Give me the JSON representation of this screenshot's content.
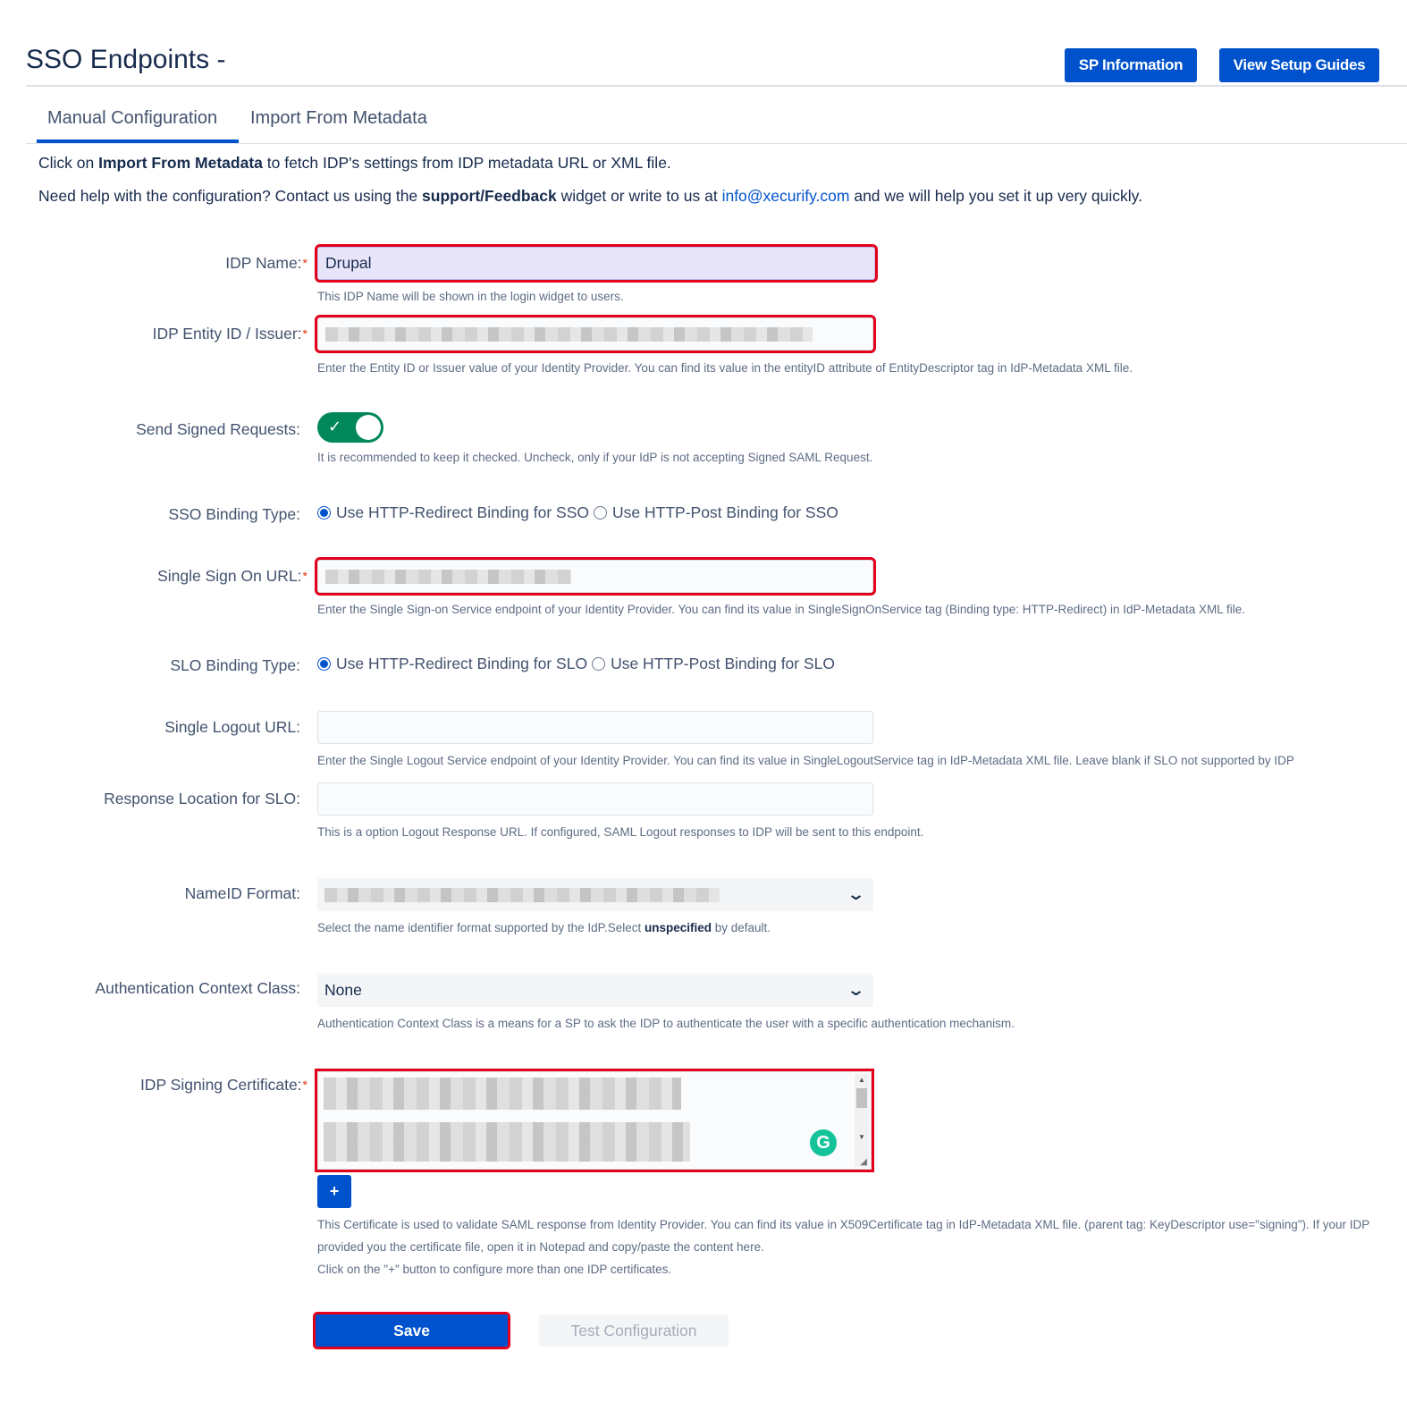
{
  "header": {
    "title": "SSO Endpoints -",
    "sp_info_label": "SP Information",
    "setup_guides_label": "View Setup Guides"
  },
  "tabs": [
    {
      "label": "Manual Configuration",
      "active": true
    },
    {
      "label": "Import From Metadata",
      "active": false
    }
  ],
  "intro": {
    "line1_pre": "Click on ",
    "line1_bold": "Import From Metadata",
    "line1_post": " to fetch IDP's settings from IDP metadata URL or XML file.",
    "line2_pre": "Need help with the configuration? Contact us using the ",
    "line2_bold": "support/Feedback",
    "line2_mid": " widget or write to us at ",
    "line2_link": "info@xecurify.com",
    "line2_post": " and we will help you set it up very quickly."
  },
  "form": {
    "idp_name": {
      "label": "IDP Name:",
      "value": "Drupal",
      "help": "This IDP Name will be shown in the login widget to users."
    },
    "entity_id": {
      "label": "IDP Entity ID / Issuer:",
      "help": "Enter the Entity ID or Issuer value of your Identity Provider. You can find its value in the entityID attribute of EntityDescriptor tag in IdP-Metadata XML file."
    },
    "signed_requests": {
      "label": "Send Signed Requests:",
      "checked": true,
      "help": "It is recommended to keep it checked. Uncheck, only if your IdP is not accepting Signed SAML Request."
    },
    "sso_binding": {
      "label": "SSO Binding Type:",
      "option_redirect": "Use HTTP-Redirect Binding for SSO",
      "option_post": "Use HTTP-Post Binding for SSO",
      "selected": "redirect"
    },
    "sso_url": {
      "label": "Single Sign On URL:",
      "help": "Enter the Single Sign-on Service endpoint of your Identity Provider. You can find its value in SingleSignOnService tag (Binding type: HTTP-Redirect) in IdP-Metadata XML file."
    },
    "slo_binding": {
      "label": "SLO Binding Type:",
      "option_redirect": "Use HTTP-Redirect Binding for SLO",
      "option_post": "Use HTTP-Post Binding for SLO",
      "selected": "redirect"
    },
    "logout_url": {
      "label": "Single Logout URL:",
      "value": "",
      "help": "Enter the Single Logout Service endpoint of your Identity Provider. You can find its value in SingleLogoutService tag in IdP-Metadata XML file. Leave blank if SLO not supported by IDP"
    },
    "response_location": {
      "label": "Response Location for SLO:",
      "value": "",
      "help": "This is a option Logout Response URL. If configured, SAML Logout responses to IDP will be sent to this endpoint."
    },
    "nameid_format": {
      "label": "NameID Format:",
      "help_pre": "Select the name identifier format supported by the IdP.Select ",
      "help_bold": "unspecified",
      "help_post": " by default."
    },
    "auth_context": {
      "label": "Authentication Context Class:",
      "value": "None",
      "help": "Authentication Context Class is a means for a SP to ask the IDP to authenticate the user with a specific authentication mechanism."
    },
    "signing_cert": {
      "label": "IDP Signing Certificate:",
      "add_label": "+",
      "help_line1": "This Certificate is used to validate SAML response from Identity Provider. You can find its value in X509Certificate tag in IdP-Metadata XML file. (parent tag: KeyDescriptor use=\"signing\"). If your IDP",
      "help_line2": "provided you the certificate file, open it in Notepad and copy/paste the content here.",
      "help_line3": "Click on the \"+\" button to configure more than one IDP certificates."
    }
  },
  "actions": {
    "save_label": "Save",
    "test_label": "Test Configuration"
  },
  "required_mark": "*",
  "icons": {
    "toggle_check": "check-icon",
    "select_arrow": "chevron-down-icon",
    "grammarly": "grammarly-icon"
  },
  "colors": {
    "primary": "#0052cc",
    "highlight": "#e3001b",
    "toggle_on": "#00875a",
    "required": "#de350b"
  }
}
